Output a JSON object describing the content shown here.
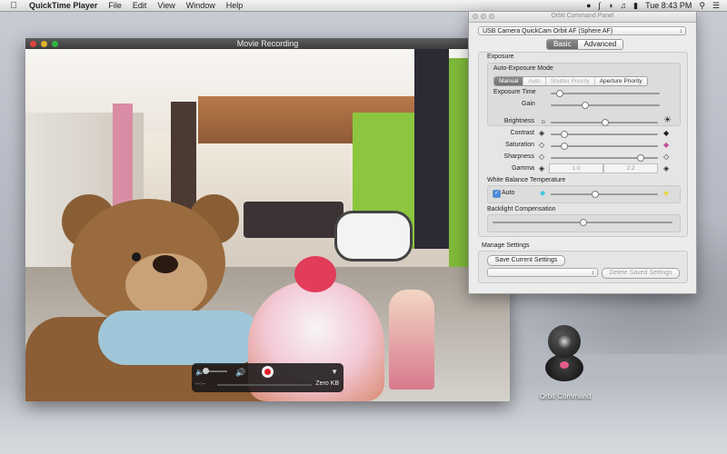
{
  "menubar": {
    "app": "QuickTime Player",
    "items": [
      "File",
      "Edit",
      "View",
      "Window",
      "Help"
    ],
    "clock": "Tue 8:43 PM"
  },
  "movie_window": {
    "title": "Movie Recording",
    "controls": {
      "time": "--:--",
      "size": "Zero KB"
    }
  },
  "panel": {
    "title": "Orbit Command Panel",
    "camera": "USB Camera QuickCam Orbit AF (Sphere AF)",
    "tabs": [
      "Basic",
      "Advanced"
    ],
    "exposure": {
      "section": "Exposure",
      "mode_label": "Auto-Exposure Mode",
      "modes": [
        "Manual",
        "Auto",
        "Shutter Priority",
        "Aperture Priority"
      ],
      "exposure_time_label": "Exposure Time",
      "exposure_time": 0.05,
      "gain_label": "Gain",
      "gain": 0.3
    },
    "image": {
      "brightness_label": "Brightness",
      "brightness": 0.5,
      "contrast_label": "Contrast",
      "contrast": 0.1,
      "saturation_label": "Saturation",
      "saturation": 0.1,
      "sharpness_label": "Sharpness",
      "sharpness": 0.85,
      "gamma_label": "Gamma",
      "gamma_min": "1.0",
      "gamma_max": "2.2"
    },
    "white_balance": {
      "section": "White Balance Temperature",
      "auto_label": "Auto",
      "value": 0.4
    },
    "backlight": {
      "section": "Backlight Compensation",
      "value": 0.5
    },
    "manage": {
      "section": "Manage Settings",
      "save_button": "Save Current Settings",
      "delete_button": "Delete Saved Settings"
    }
  },
  "desktop": {
    "icon_label": "Orbit Command"
  }
}
